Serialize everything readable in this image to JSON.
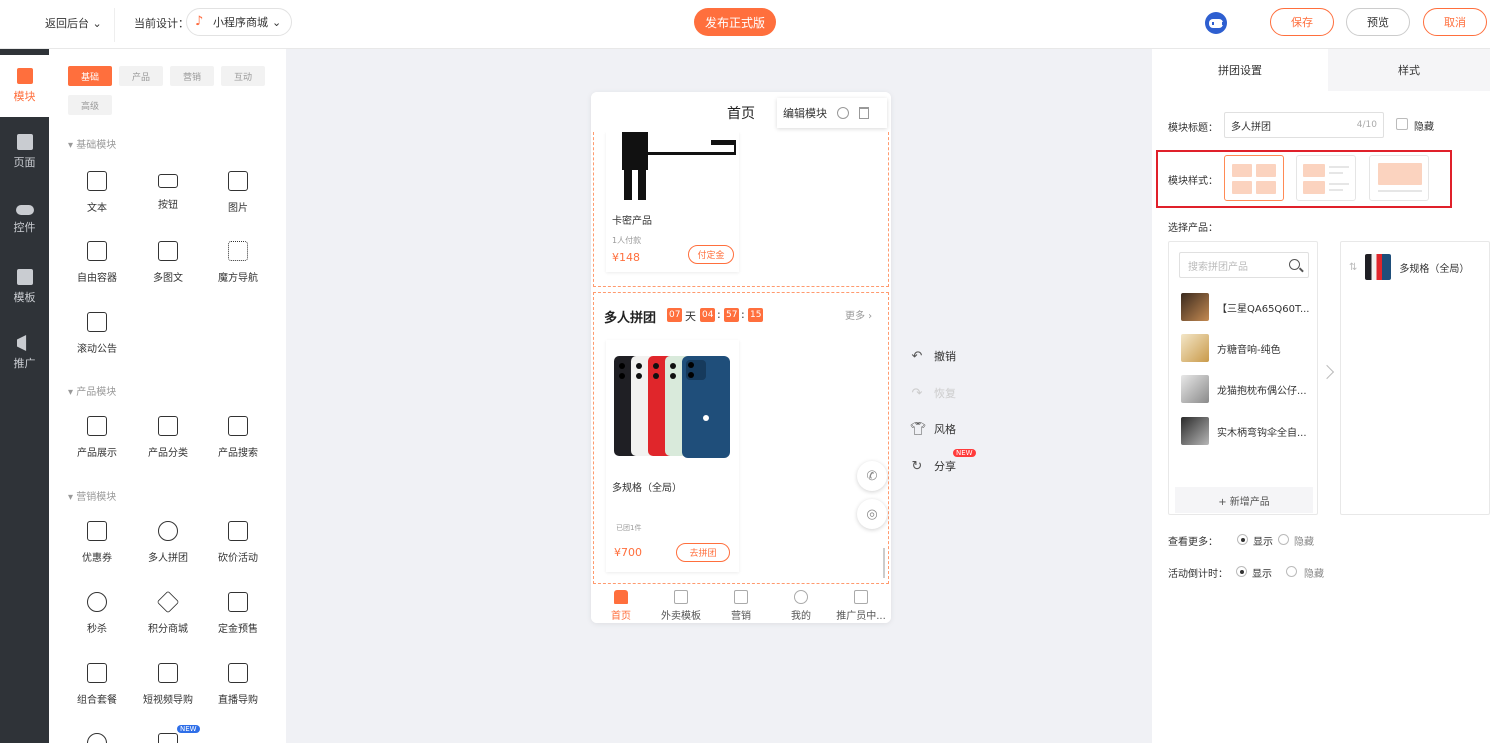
{
  "topbar": {
    "back_label": "返回后台",
    "current_design_label": "当前设计：",
    "app_name": "小程序商城",
    "publish_label": "发布正式版",
    "save_label": "保存",
    "preview_label": "预览",
    "cancel_label": "取消"
  },
  "darknav": {
    "items": [
      {
        "label": "模块",
        "icon": "blocks-icon"
      },
      {
        "label": "页面",
        "icon": "page-icon"
      },
      {
        "label": "控件",
        "icon": "toggle-icon"
      },
      {
        "label": "模板",
        "icon": "template-icon"
      },
      {
        "label": "推广",
        "icon": "megaphone-icon"
      }
    ]
  },
  "components": {
    "tabs": [
      "基础",
      "产品",
      "营销",
      "互动",
      "高级"
    ],
    "sections": {
      "basic": "基础模块",
      "product": "产品模块",
      "marketing": "营销模块"
    },
    "basic_items": [
      "文本",
      "按钮",
      "图片",
      "自由容器",
      "多图文",
      "魔方导航",
      "滚动公告"
    ],
    "product_items": [
      "产品展示",
      "产品分类",
      "产品搜索"
    ],
    "marketing_items": [
      "优惠券",
      "多人拼团",
      "砍价活动",
      "秒杀",
      "积分商城",
      "定金预售",
      "组合套餐",
      "短视频导购",
      "直播导购"
    ],
    "new_tag": "NEW"
  },
  "phone": {
    "page_title": "首页",
    "edit_module_label": "编辑模块",
    "card_a": {
      "name": "卡密产品",
      "sold": "1人付款",
      "price": "¥148",
      "button": "付定金"
    },
    "groupbuy": {
      "title": "多人拼团",
      "days": "07",
      "day_unit": "天",
      "hours": "04",
      "minutes": "57",
      "seconds": "15",
      "sep": ":",
      "more": "更多 ›",
      "product_name": "多规格（全局）",
      "grouped": "已团1件",
      "price": "¥700",
      "button": "去拼团"
    },
    "tabbar": [
      "首页",
      "外卖模板",
      "营销",
      "我的",
      "推广员中..."
    ]
  },
  "side_actions": {
    "undo": "撤销",
    "redo": "恢复",
    "style": "风格",
    "share": "分享",
    "new_tag": "NEW"
  },
  "right_panel": {
    "tab_settings": "拼团设置",
    "tab_style": "样式",
    "module_title_label": "模块标题：",
    "module_title_value": "多人拼团",
    "module_title_count": "4/10",
    "hide_label": "隐藏",
    "module_style_label": "模块样式：",
    "select_product_label": "选择产品：",
    "search_placeholder": "搜索拼团产品",
    "products": [
      "【三星QA65Q60T...",
      "方糖音响-纯色",
      "龙猫抱枕布偶公仔...",
      "实木柄弯钩伞全自..."
    ],
    "add_product": "+ 新增产品",
    "selected_product": "多规格（全局）",
    "view_more_label": "查看更多：",
    "countdown_label": "活动倒计时：",
    "show_label": "显示",
    "hide_opt_label": "隐藏"
  },
  "colors": {
    "accent": "#ff6f3d",
    "dark_nav": "#2f3338",
    "highlight_border": "#e0202a"
  }
}
